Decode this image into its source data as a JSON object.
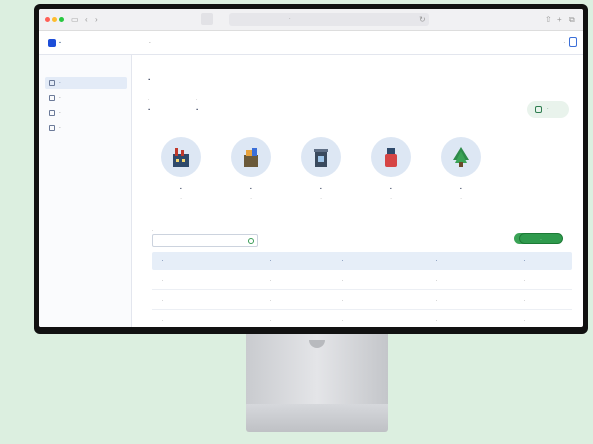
{
  "browser": {
    "url": "·"
  },
  "app": {
    "logo_text": "·",
    "title": "·",
    "user_label": "·"
  },
  "sidebar": {
    "items": [
      {
        "label": "·"
      },
      {
        "label": "·"
      },
      {
        "label": "·"
      },
      {
        "label": "·"
      }
    ]
  },
  "main": {
    "heading": "·",
    "stats": [
      {
        "label": "·",
        "value": "·"
      },
      {
        "label": "·",
        "value": "·"
      }
    ],
    "share_label": "·"
  },
  "impacts": [
    {
      "icon": "factory-icon",
      "value": "·",
      "desc": "·"
    },
    {
      "icon": "recycle-icon",
      "value": "·",
      "desc": "·"
    },
    {
      "icon": "bin-icon",
      "value": "·",
      "desc": "·"
    },
    {
      "icon": "phone-icon",
      "value": "·",
      "desc": "·"
    },
    {
      "icon": "tree-icon",
      "value": "·",
      "desc": "·"
    }
  ],
  "filters": {
    "search_label": "·",
    "btn1": "·",
    "btn2": "·"
  },
  "table": {
    "headers": [
      "·",
      "·",
      "·",
      "·",
      "·"
    ],
    "rows": [
      [
        "·",
        "·",
        "·",
        "·",
        "·"
      ],
      [
        "·",
        "·",
        "·",
        "·",
        "·"
      ],
      [
        "·",
        "·",
        "·",
        "·",
        "·"
      ]
    ]
  },
  "colors": {
    "accent_green": "#3aa356",
    "brand_blue": "#1d4ed8",
    "background": "#dcefe0"
  }
}
